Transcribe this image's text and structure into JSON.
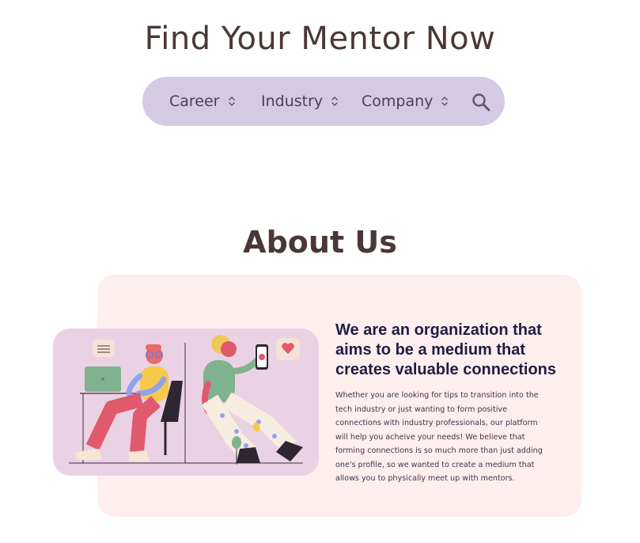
{
  "hero": {
    "title": "Find Your Mentor Now"
  },
  "search": {
    "filters": [
      {
        "label": "Career",
        "icon": "sort-chevrons-icon"
      },
      {
        "label": "Industry",
        "icon": "sort-chevrons-icon"
      },
      {
        "label": "Company",
        "icon": "sort-chevrons-icon"
      }
    ],
    "search_icon": "search-icon"
  },
  "about": {
    "title": "About Us",
    "heading": "We are an organization that aims to be a medium that creates valuable connections",
    "body": "Whether you are looking for tips to transition into the tech industry or just wanting to form positive connections with industry professionals, our platform will help you acheive your needs! We believe that forming connections is so much more than just adding one's profile, so we wanted to create a medium that allows you to physically meet up with mentors."
  },
  "colors": {
    "title": "#4a3836",
    "search_bar": "#d4cae3",
    "about_card": "#ffeeee",
    "illustration_card": "#ead2e4",
    "heading": "#1f1d45"
  }
}
